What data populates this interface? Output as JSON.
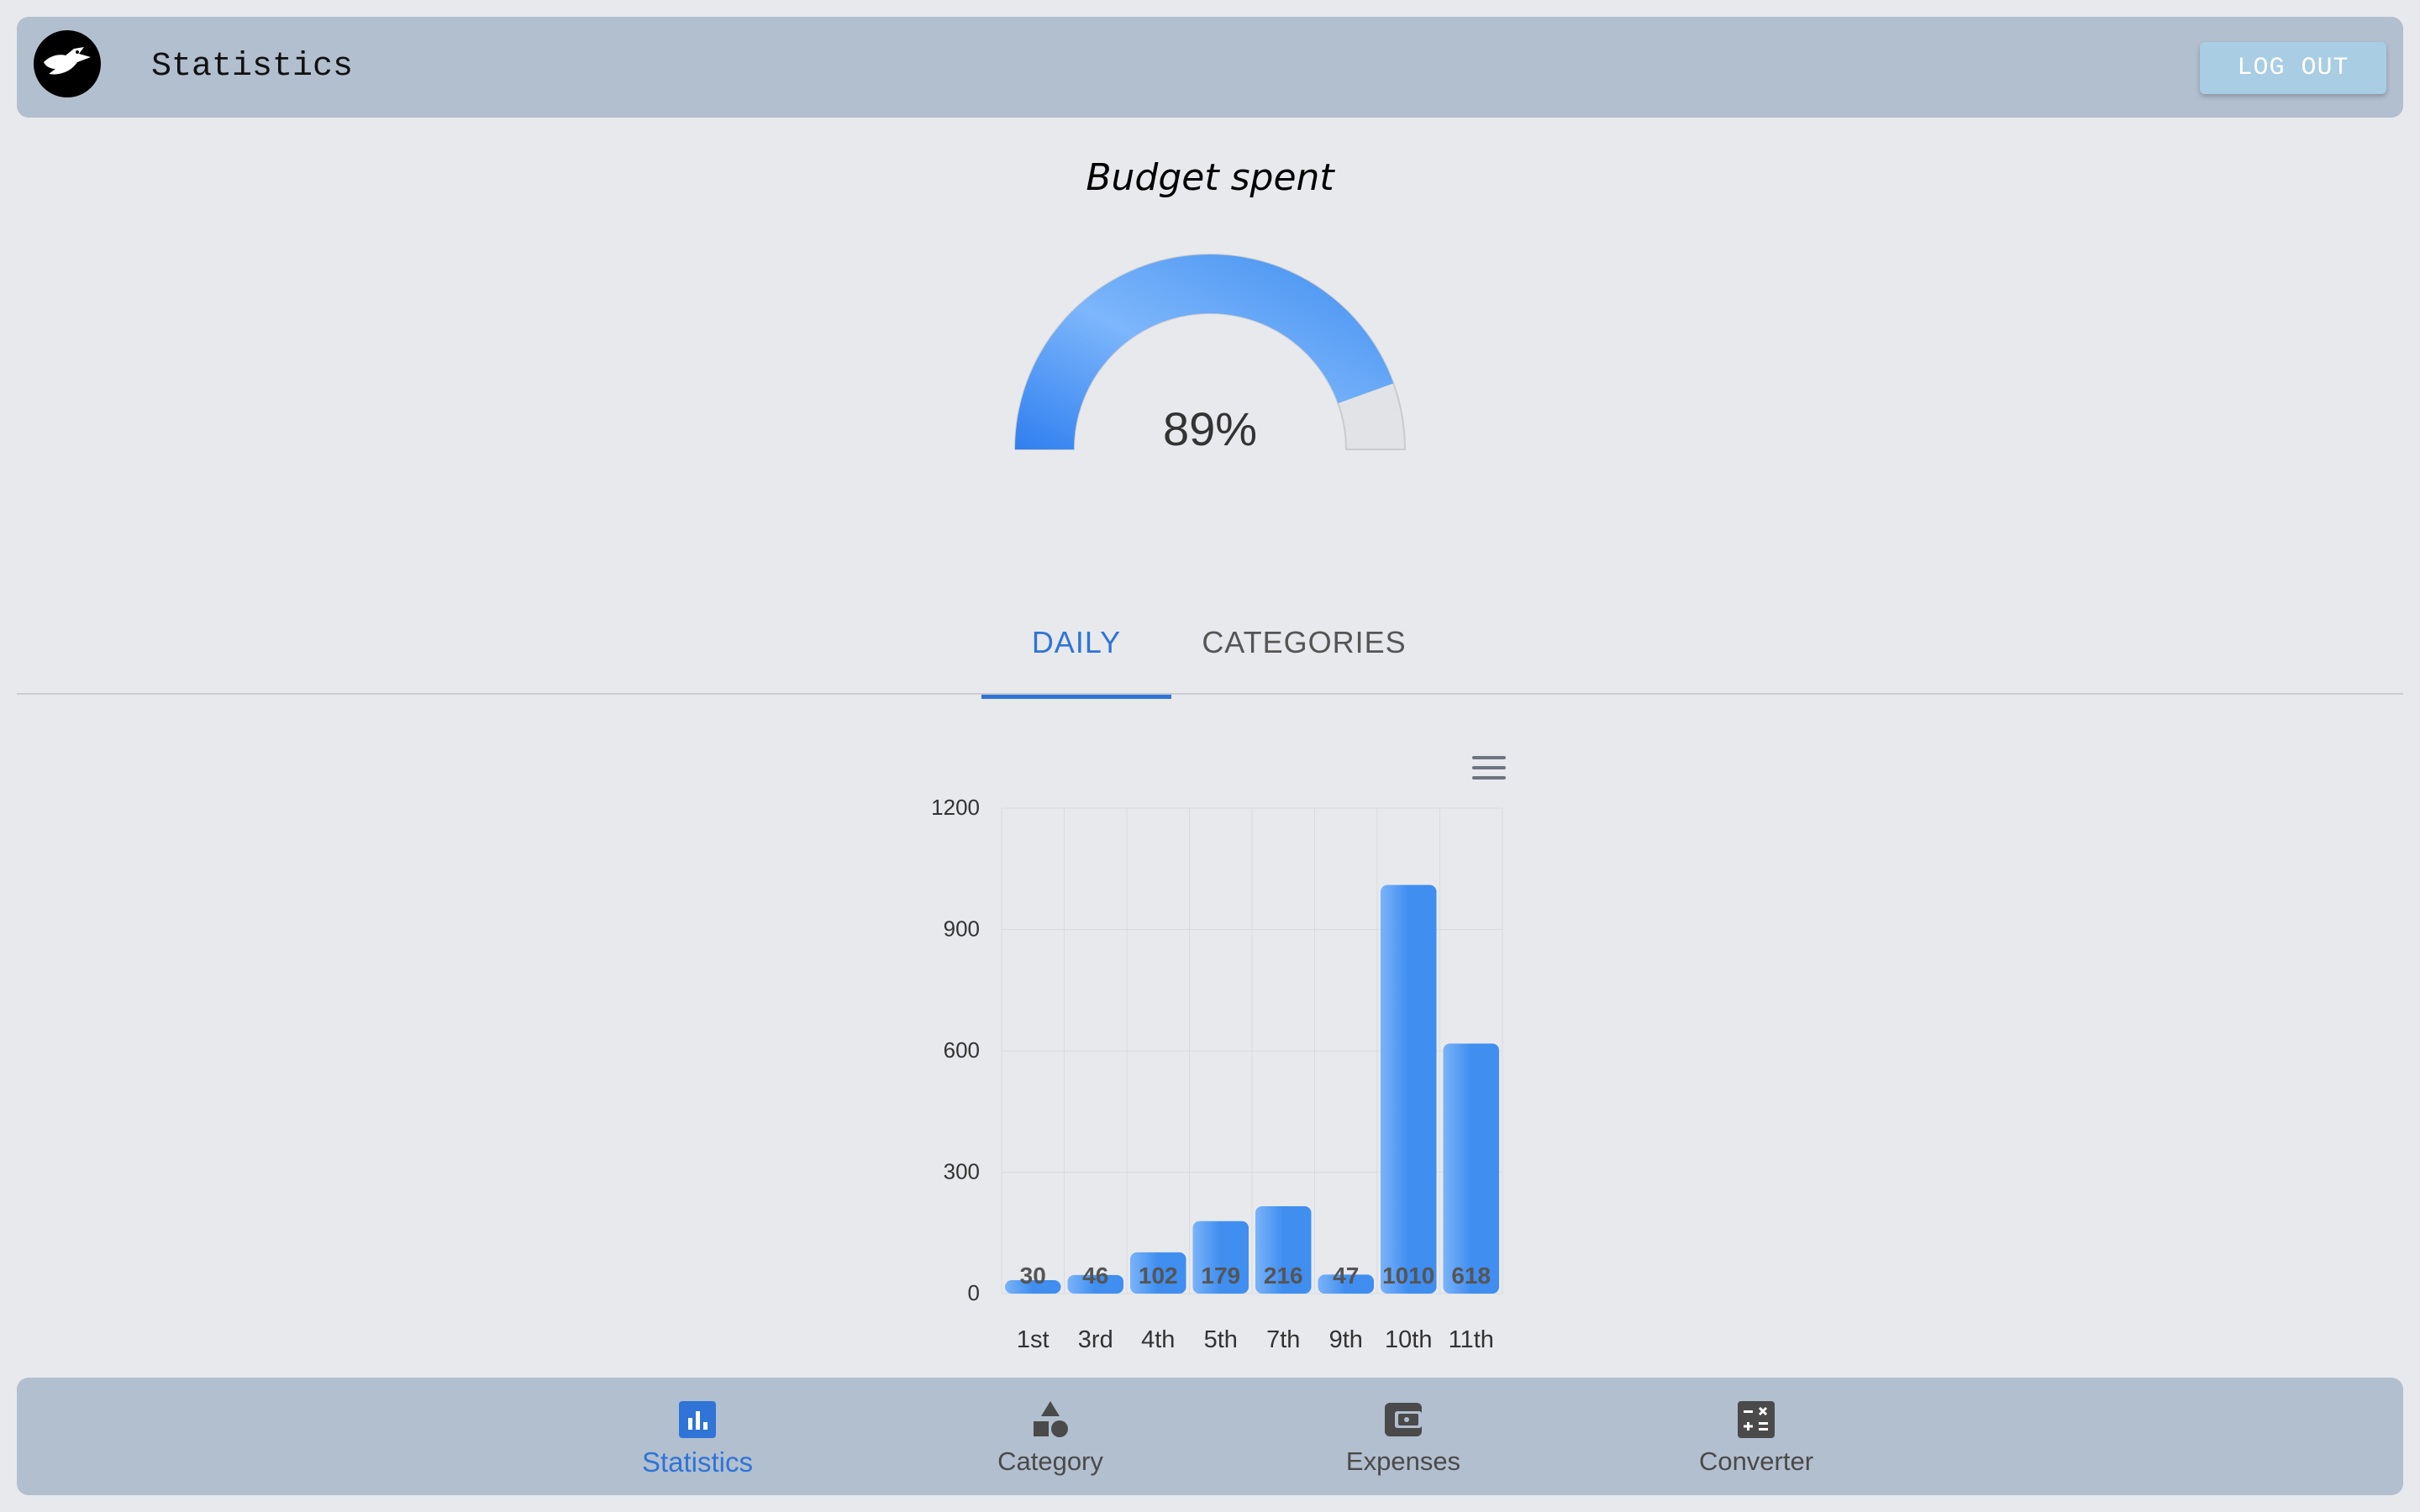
{
  "header": {
    "title": "Statistics",
    "logout_label": "LOG OUT"
  },
  "gauge": {
    "title": "Budget spent",
    "value_label": "89%",
    "value": 0.89,
    "color": "#3f8ef0",
    "track_color": "#e2e3e6"
  },
  "tabs": [
    {
      "label": "DAILY",
      "active": true
    },
    {
      "label": "CATEGORIES",
      "active": false
    }
  ],
  "chart_data": {
    "type": "bar",
    "categories": [
      "1st",
      "3rd",
      "4th",
      "5th",
      "7th",
      "9th",
      "10th",
      "11th"
    ],
    "values": [
      30,
      46,
      102,
      179,
      216,
      47,
      1010,
      618
    ],
    "ylim": [
      0,
      1200
    ],
    "yticks": [
      0,
      300,
      600,
      900,
      1200
    ],
    "grid": true,
    "data_labels": true,
    "bar_color": "#3f8ef0"
  },
  "nav": [
    {
      "label": "Statistics",
      "icon": "bar-chart-icon",
      "active": true
    },
    {
      "label": "Category",
      "icon": "shapes-icon",
      "active": false
    },
    {
      "label": "Expenses",
      "icon": "wallet-icon",
      "active": false
    },
    {
      "label": "Converter",
      "icon": "calculator-icon",
      "active": false
    }
  ],
  "colors": {
    "accent": "#2f74d6",
    "bar": "#bfc9d6"
  }
}
